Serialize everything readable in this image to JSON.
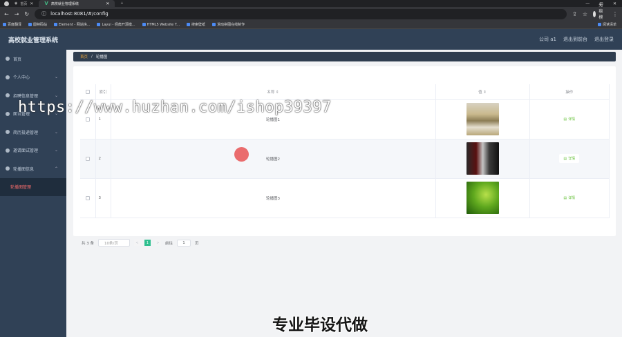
{
  "browser": {
    "tabs": [
      {
        "label": "首页"
      },
      {
        "label": "高校就业管理系统"
      }
    ],
    "url": "localhost:8081/#/config",
    "profile": "无痕模式",
    "bookmarks": [
      {
        "label": "百度翻译"
      },
      {
        "label": "圆特码站"
      },
      {
        "label": "Element - 网站快..."
      },
      {
        "label": "Layui - 经典开源模..."
      },
      {
        "label": "HTML5 Website T..."
      },
      {
        "label": "搜索壁纸"
      },
      {
        "label": "滑动拼图在线制作"
      }
    ],
    "bookmarks_right": "阅读清单"
  },
  "header": {
    "title": "高校就业管理系统",
    "links": [
      "公司 a1",
      "退出到前台",
      "退出登录"
    ]
  },
  "sidebar": {
    "items": [
      {
        "label": "首页",
        "chevron": ""
      },
      {
        "label": "个人中心",
        "chevron": "⌄"
      },
      {
        "label": "招聘信息管理",
        "chevron": "⌄"
      },
      {
        "label": "面试管理",
        "chevron": "⌄"
      },
      {
        "label": "简历投递管理",
        "chevron": "⌄"
      },
      {
        "label": "邀请面试管理",
        "chevron": "⌄"
      },
      {
        "label": "轮播图信息",
        "chevron": "⌃"
      }
    ],
    "sub_item": "轮播图管理"
  },
  "breadcrumb": {
    "home": "首页",
    "sep": "/",
    "current": "轮播图"
  },
  "table": {
    "headers": {
      "index": "索引",
      "name": "名称 ⇕",
      "value": "值 ⇕",
      "actions": "操作"
    },
    "rows": [
      {
        "index": "1",
        "name": "轮播图1",
        "action": "详情"
      },
      {
        "index": "2",
        "name": "轮播图2",
        "action": "详情"
      },
      {
        "index": "3",
        "name": "轮播图3",
        "action": "详情"
      }
    ]
  },
  "pagination": {
    "total": "共 3 条",
    "page_size": "10条/页",
    "prev": "<",
    "current": "1",
    "next": ">",
    "goto_label": "前往",
    "goto_value": "1",
    "page_unit": "页"
  },
  "overlay": {
    "watermark": "https://www.huzhan.com/ishop39397",
    "caption": "专业毕设代做"
  },
  "colors": {
    "sidebar_bg": "#304156",
    "accent": "#2fbf8f",
    "active_menu": "#f56c6c"
  }
}
